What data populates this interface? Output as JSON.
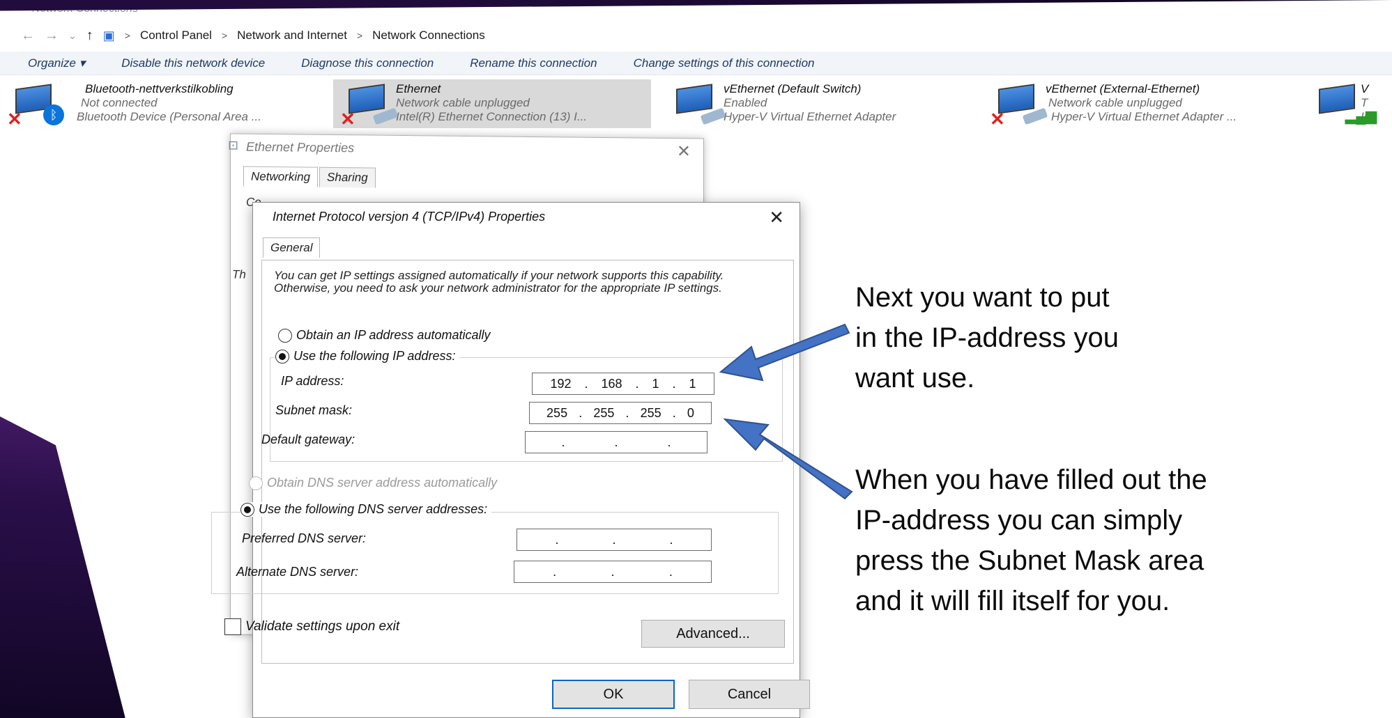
{
  "explorer": {
    "window_title": "Network Connections",
    "breadcrumb": [
      "Control Panel",
      "Network and Internet",
      "Network Connections"
    ],
    "toolbar": [
      "Organize ▾",
      "Disable this network device",
      "Diagnose this connection",
      "Rename this connection",
      "Change settings of this connection"
    ],
    "adapters": [
      {
        "name": "Bluetooth-nettverkstilkobling",
        "status": "Not connected",
        "device": "Bluetooth Device (Personal Area ..."
      },
      {
        "name": "Ethernet",
        "status": "Network cable unplugged",
        "device": "Intel(R) Ethernet Connection (13) I..."
      },
      {
        "name": "vEthernet (Default Switch)",
        "status": "Enabled",
        "device": "Hyper-V Virtual Ethernet Adapter"
      },
      {
        "name": "vEthernet (External-Ethernet)",
        "status": "Network cable unplugged",
        "device": "Hyper-V Virtual Ethernet Adapter ..."
      },
      {
        "name": "V",
        "status": "T",
        "device": "Ir"
      }
    ]
  },
  "eth_props": {
    "title": "Ethernet Properties",
    "tabs": [
      "Networking",
      "Sharing"
    ],
    "frag_connect": "Co",
    "frag_this": "Th"
  },
  "ipv4": {
    "title": "Internet Protocol versjon 4 (TCP/IPv4) Properties",
    "tab": "General",
    "intro": "You can get IP settings assigned automatically if your network supports this capability. Otherwise, you need to ask your network administrator for the appropriate IP settings.",
    "obtain_ip": "Obtain an IP address automatically",
    "use_ip": "Use the following IP address:",
    "ip_label": "IP address:",
    "ip_octets": [
      "192",
      "168",
      "1",
      "1"
    ],
    "subnet_label": "Subnet mask:",
    "subnet_octets": [
      "255",
      "255",
      "255",
      "0"
    ],
    "gateway_label": "Default gateway:",
    "obtain_dns": "Obtain DNS server address automatically",
    "use_dns": "Use the following DNS server addresses:",
    "pref_dns_label": "Preferred DNS server:",
    "alt_dns_label": "Alternate DNS server:",
    "validate": "Validate settings upon exit",
    "advanced": "Advanced...",
    "ok": "OK",
    "cancel": "Cancel"
  },
  "notes": {
    "note1": [
      "Next you want to put",
      "in the IP-address you",
      "want use."
    ],
    "note2": [
      "When you have filled out the",
      "IP-address you can simply",
      "press the Subnet Mask area",
      "and it will fill itself for you."
    ]
  },
  "colors": {
    "arrow": "#4472c4",
    "arrow_stroke": "#2f528f",
    "toolbar_text": "#1f3a66"
  }
}
